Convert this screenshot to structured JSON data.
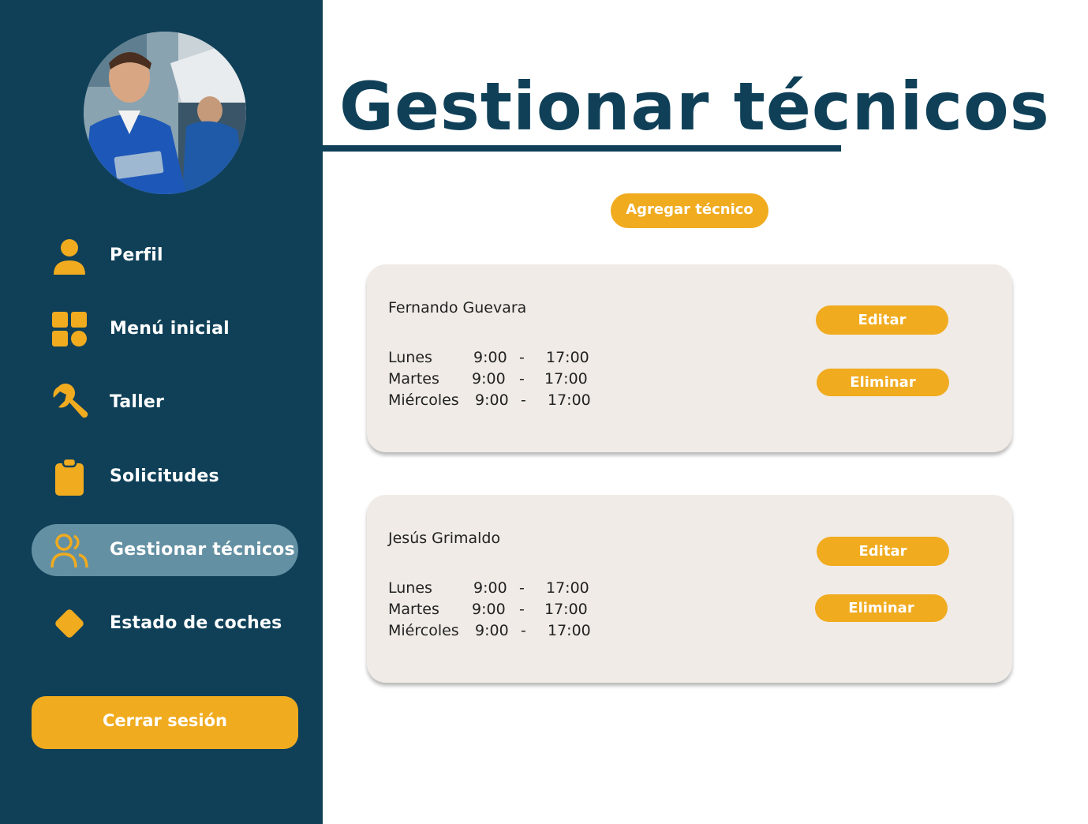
{
  "sidebar": {
    "avatar_alt": "",
    "items": [
      {
        "label": "Perfil",
        "icon": "person-icon"
      },
      {
        "label": "Menú inicial",
        "icon": "grid-icon"
      },
      {
        "label": "Taller",
        "icon": "wrench-icon"
      },
      {
        "label": "Solicitudes",
        "icon": "clipboard-icon"
      },
      {
        "label": "Gestionar técnicos",
        "icon": "users-icon",
        "active": true
      },
      {
        "label": "Estado de coches",
        "icon": "diamond-icon"
      }
    ],
    "logout_label": "Cerrar sesión"
  },
  "main": {
    "title": "Gestionar técnicos",
    "add_button": "Agregar técnico",
    "technicians": [
      {
        "name": "Fernando Guevara",
        "schedule": [
          {
            "day": "Lunes",
            "start": "9:00",
            "sep": "-",
            "end": "17:00"
          },
          {
            "day": "Martes",
            "start": "9:00",
            "sep": "-",
            "end": "17:00"
          },
          {
            "day": "Miércoles",
            "start": "9:00",
            "sep": "-",
            "end": "17:00"
          }
        ],
        "edit_label": "Editar",
        "delete_label": "Eliminar"
      },
      {
        "name": "Jesús Grimaldo",
        "schedule": [
          {
            "day": "Lunes",
            "start": "9:00",
            "sep": "-",
            "end": "17:00"
          },
          {
            "day": "Martes",
            "start": "9:00",
            "sep": "-",
            "end": "17:00"
          },
          {
            "day": "Miércoles",
            "start": "9:00",
            "sep": "-",
            "end": "17:00"
          }
        ],
        "edit_label": "Editar",
        "delete_label": "Eliminar"
      }
    ]
  },
  "colors": {
    "sidebar_bg": "#0f4058",
    "accent": "#f0ab1f",
    "active_item_bg": "#6390a2",
    "card_bg": "#f0ebe6",
    "title": "#0f4058"
  }
}
